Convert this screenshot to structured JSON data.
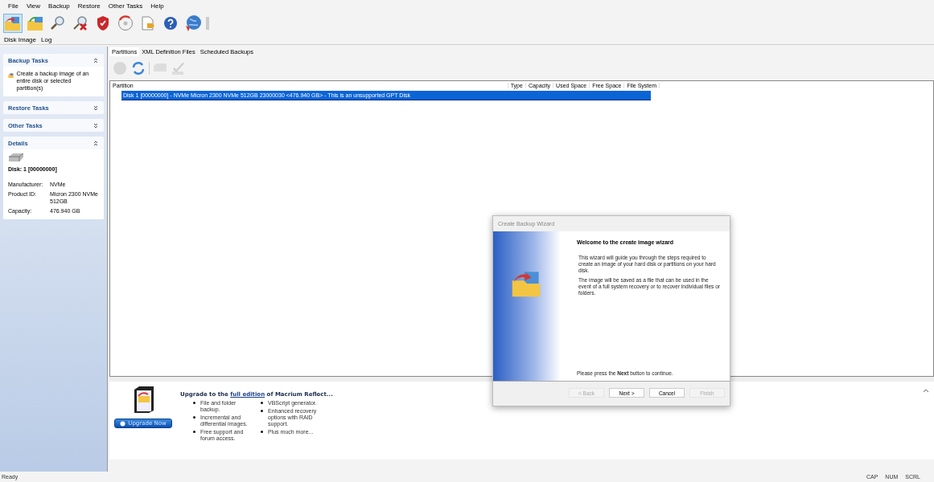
{
  "menu": [
    "File",
    "View",
    "Backup",
    "Restore",
    "Other Tasks",
    "Help"
  ],
  "toolbar": [
    {
      "kind": "backup",
      "selected": true
    },
    {
      "kind": "folder",
      "selected": false
    },
    {
      "kind": "search",
      "selected": false
    },
    {
      "kind": "delete",
      "selected": false
    },
    {
      "kind": "shield",
      "selected": false
    },
    {
      "kind": "disc",
      "selected": false
    },
    {
      "kind": "document",
      "selected": false
    },
    {
      "kind": "help",
      "selected": false
    },
    {
      "kind": "globe",
      "selected": false
    }
  ],
  "view_tabs": [
    "Disk Image",
    "Log"
  ],
  "sidebar": [
    {
      "title": "Backup Tasks",
      "expanded": true,
      "kind": "tasks",
      "items": [
        "Create a backup image of an entire disk or selected partition(s)"
      ]
    },
    {
      "title": "Restore Tasks",
      "expanded": false
    },
    {
      "title": "Other Tasks",
      "expanded": false
    },
    {
      "title": "Details",
      "expanded": true,
      "kind": "details",
      "disk": "Disk: 1 [00000000]",
      "fields": [
        {
          "label": "Manufacturer:",
          "value": "NVMe"
        },
        {
          "label": "Product ID:",
          "value": "Micron 2300 NVMe 512GB"
        },
        {
          "label": "Capacity:",
          "value": "476.940 GB"
        }
      ]
    }
  ],
  "tabs": [
    {
      "label": "Partitions",
      "selected": true
    },
    {
      "label": "XML Definition Files",
      "selected": false
    },
    {
      "label": "Scheduled Backups",
      "selected": false
    }
  ],
  "table": {
    "columns": [
      "Partition",
      "Type",
      "Capacity",
      "Used Space",
      "Free Space",
      "File System"
    ],
    "rows": [
      {
        "text": "Disk 1 [00000000] - NVMe Micron 2300 NVMe 512GB 23000030  <476.940 GB> - This is an unsupported GPT Disk",
        "selected": true
      }
    ]
  },
  "promo": {
    "heading_before": "Upgrade to the ",
    "link": "full edition",
    "heading_after": " of Macrium Reflect...",
    "button": "Upgrade Now",
    "columns": [
      [
        "File and folder backup.",
        "Incremental and differential images.",
        "Free support and forum access."
      ],
      [
        "VBScript generator.",
        "Enhanced recovery options with RAID support.",
        "Plus much more..."
      ]
    ]
  },
  "dialog": {
    "title": "Create Backup Wizard",
    "heading": "Welcome to the create image wizard",
    "paragraphs": [
      "This wizard will guide you through the steps required to create an image of your hard disk or partitions on your hard disk.",
      "The image will be saved as a file that can be used in the event of a full system recovery or to recover individual files or folders."
    ],
    "footer": "Please press the **Next** button to continue.",
    "buttons": [
      {
        "label": "< Back",
        "disabled": true
      },
      {
        "label": "Next >",
        "disabled": false
      },
      {
        "label": "Cancel",
        "disabled": false
      },
      {
        "label": "Finish",
        "disabled": true
      }
    ]
  },
  "status_bar": {
    "text": "Ready",
    "indicators": [
      "CAP",
      "NUM",
      "SCRL"
    ]
  }
}
